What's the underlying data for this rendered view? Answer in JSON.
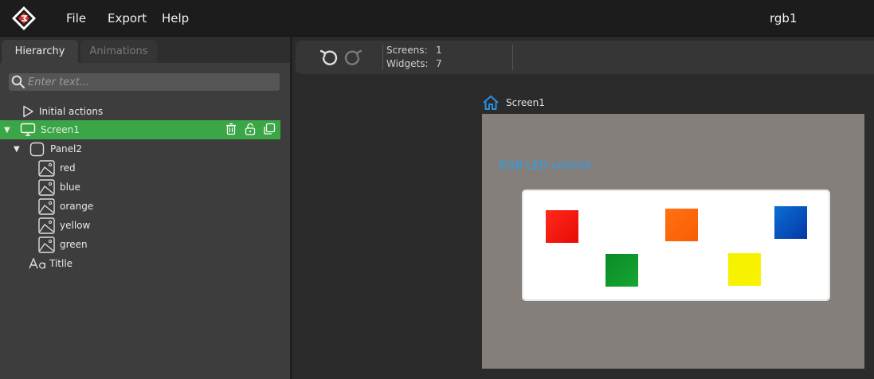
{
  "menu": {
    "file": "File",
    "export": "Export",
    "help": "Help"
  },
  "project_title": "rgb1",
  "tabs": {
    "hierarchy": "Hierarchy",
    "animations": "Animations"
  },
  "search": {
    "placeholder": "Enter text..."
  },
  "tree": {
    "initial_actions": "Initial actions",
    "screen": "Screen1",
    "panel": "Panel2",
    "images": [
      "red",
      "blue",
      "orange",
      "yellow",
      "green"
    ],
    "label": "Titlle"
  },
  "stats": {
    "screens_label": "Screens:",
    "screens_value": "1",
    "widgets_label": "Widgets:",
    "widgets_value": "7"
  },
  "canvas": {
    "screen_name": "Screen1",
    "title_text": "RGB LED control"
  },
  "colors": {
    "accent_green": "#3aa645",
    "title_blue": "#2aa0e8",
    "canvas_bg": "#857f7c",
    "red": "#ff1a0d",
    "orange": "#ff6a0a",
    "blue": "#0a4fbf",
    "green": "#0e9a2a",
    "yellow": "#f6f200"
  },
  "icons": {
    "logo": "app-logo-icon",
    "search": "search-icon",
    "play": "play-icon",
    "screen": "monitor-icon",
    "panel": "rounded-square-icon",
    "image": "image-icon",
    "label": "text-aa-icon",
    "delete": "trash-icon",
    "lock": "unlock-icon",
    "duplicate": "copy-icon",
    "undo": "undo-icon",
    "redo": "redo-icon",
    "home": "home-icon"
  }
}
